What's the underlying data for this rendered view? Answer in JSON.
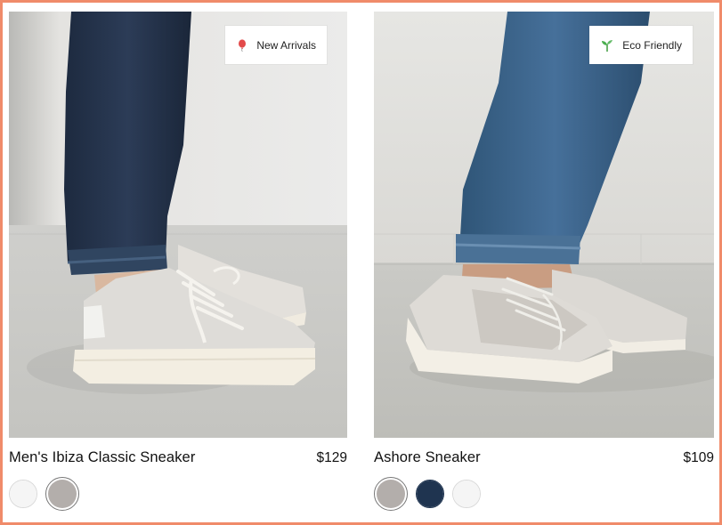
{
  "colors": {
    "frame": "#f08b6a",
    "swatch_white": "#f5f5f5",
    "swatch_grey": "#b3aeab",
    "swatch_navy": "#1f3450"
  },
  "products": [
    {
      "name": "Men's Ibiza Classic Sneaker",
      "price": "$129",
      "badge": {
        "label": "New Arrivals",
        "icon": "balloon-icon"
      },
      "swatches": [
        {
          "color": "#f5f5f5",
          "selected": false
        },
        {
          "color": "#b3aeab",
          "selected": true
        }
      ]
    },
    {
      "name": "Ashore Sneaker",
      "price": "$109",
      "badge": {
        "label": "Eco Friendly",
        "icon": "sprout-icon"
      },
      "swatches": [
        {
          "color": "#b3aeab",
          "selected": true
        },
        {
          "color": "#1f3450",
          "selected": false
        },
        {
          "color": "#f5f5f5",
          "selected": false
        }
      ]
    }
  ]
}
